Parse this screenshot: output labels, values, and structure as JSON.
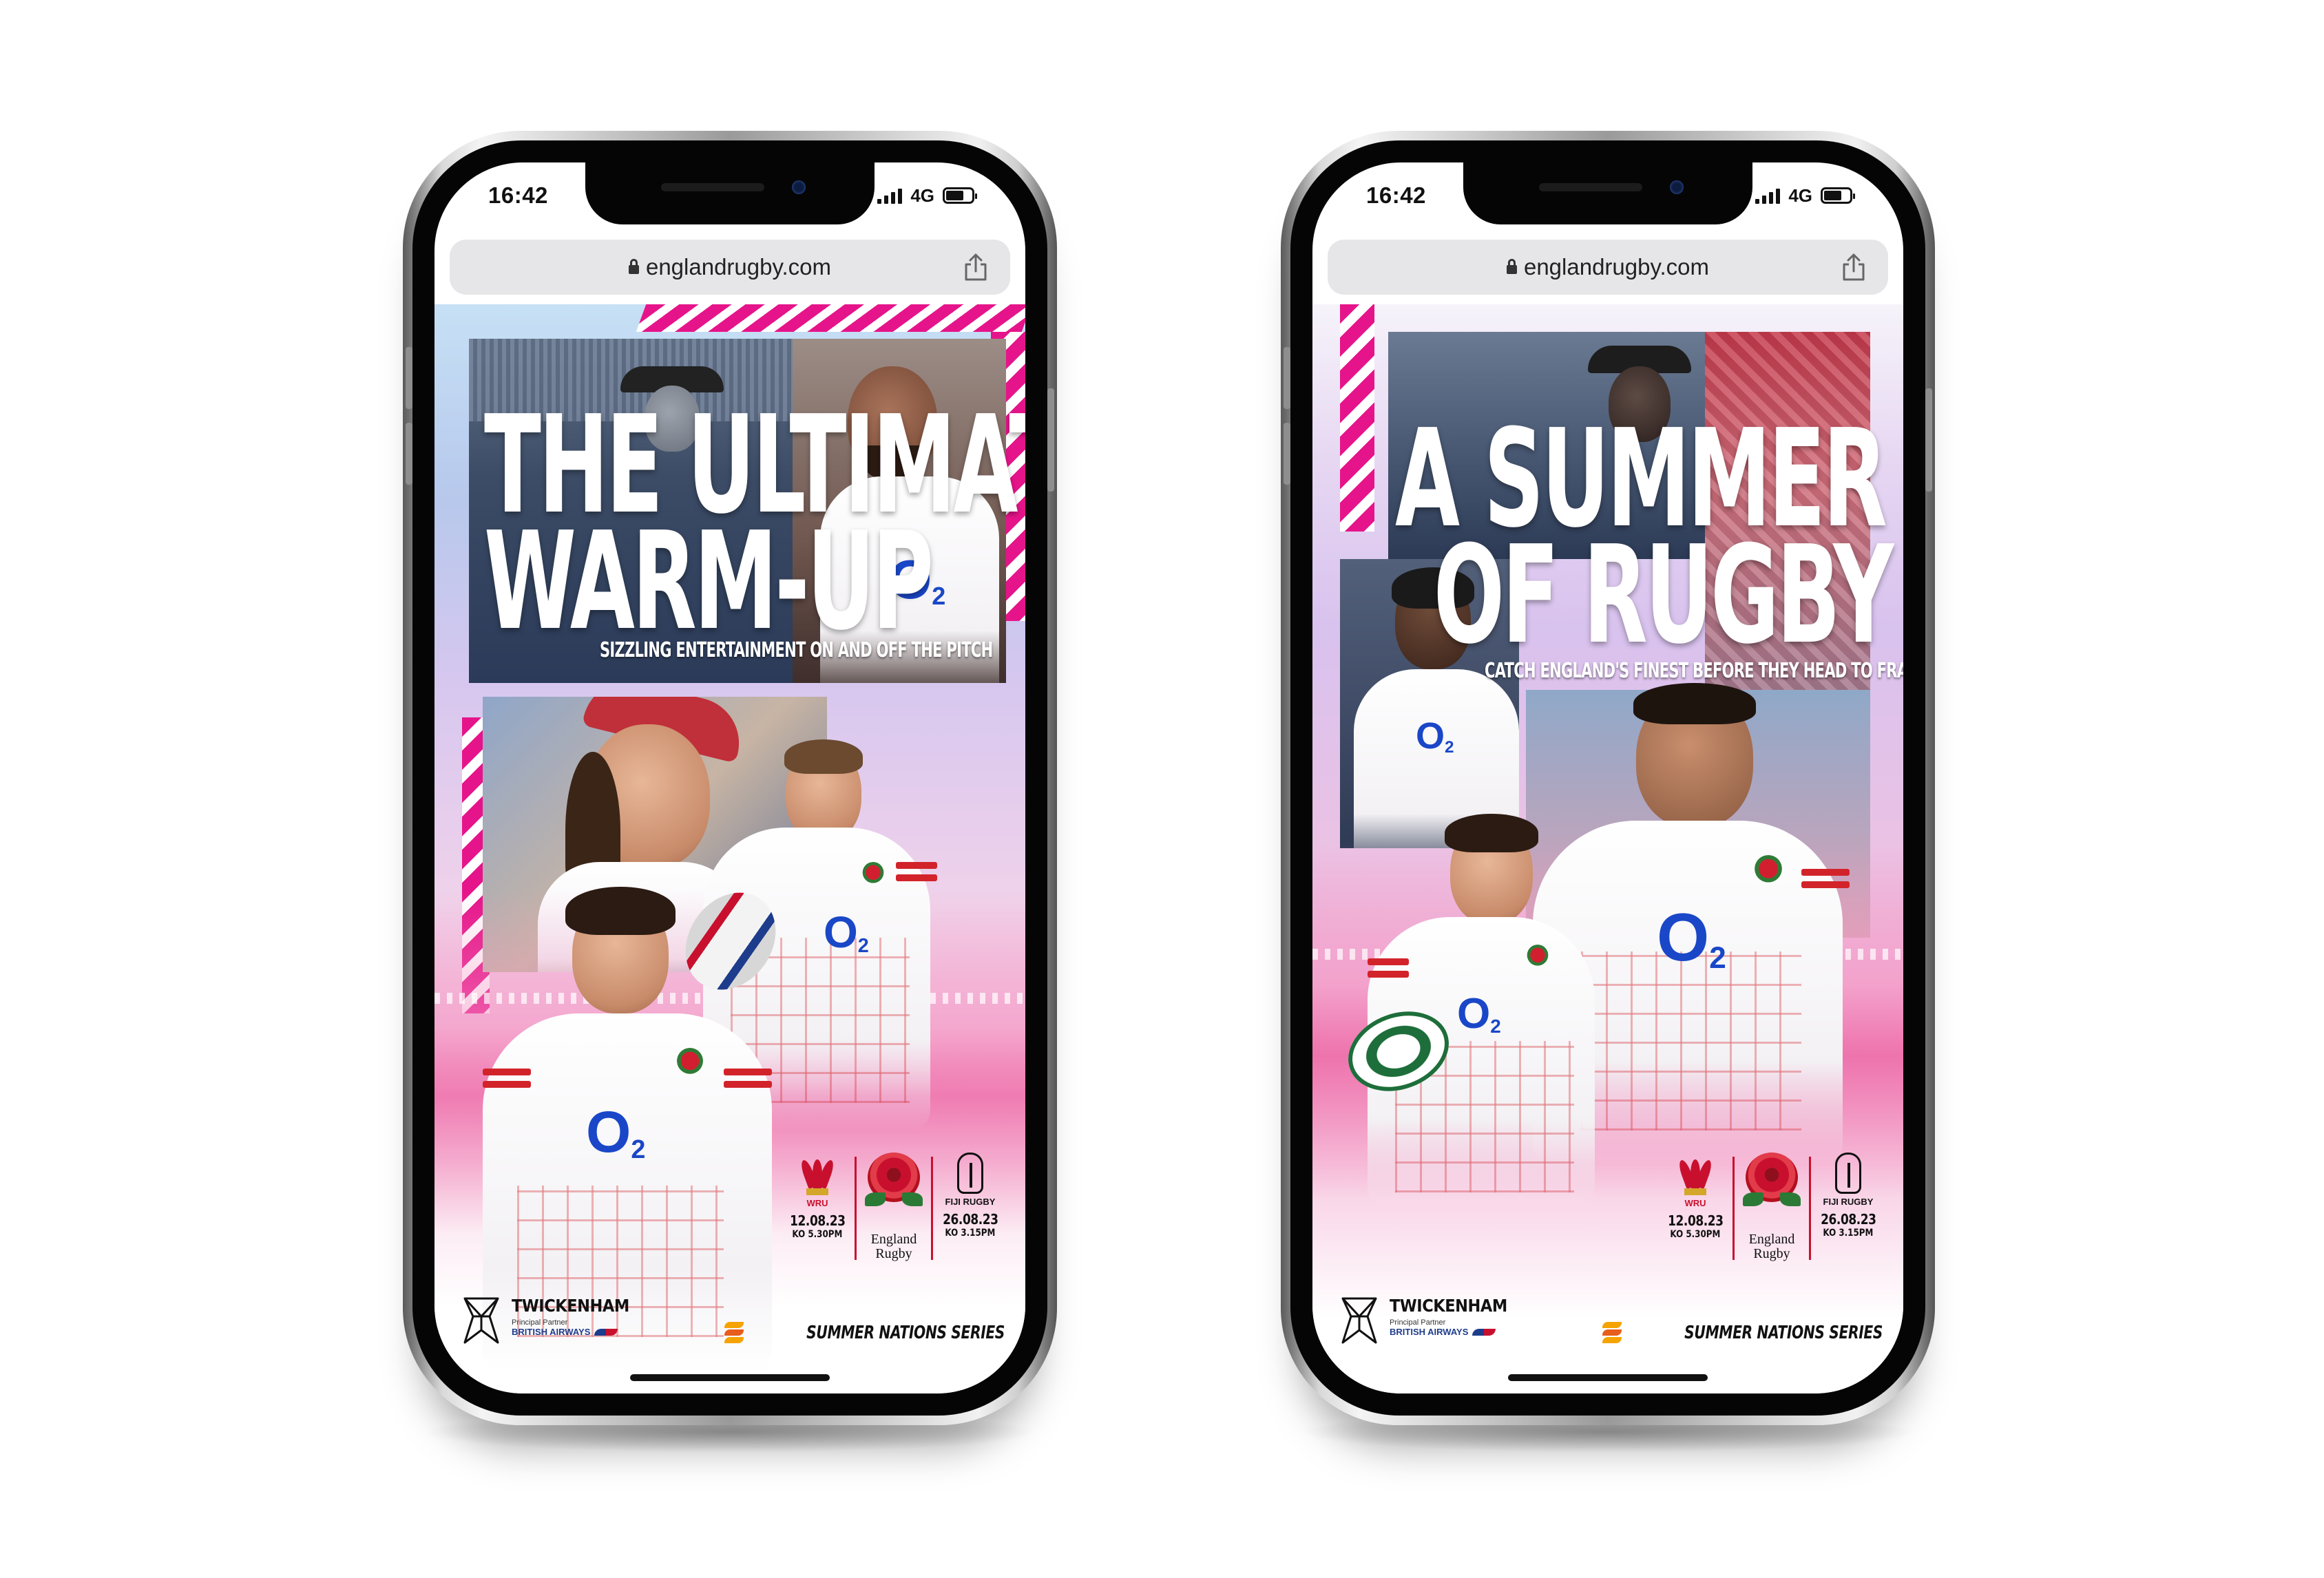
{
  "colors": {
    "accent_pink": "#e6148a",
    "england_red": "#c8102e",
    "o2_blue": "#1a47c8",
    "ba_navy": "#1e3c8c"
  },
  "phones": [
    {
      "status": {
        "time": "16:42",
        "network": "4G"
      },
      "browser": {
        "url": "englandrugby.com"
      },
      "poster": {
        "headline_line1": "THE ULTIMATE",
        "headline_line2": "WARM-UP",
        "subheadline": "SIZZLING ENTERTAINMENT ON AND OFF THE PITCH",
        "shirt_sponsor": "O",
        "shirt_sponsor_sub": "2",
        "fixtures": [
          {
            "org": "WRU",
            "date": "12.08.23",
            "kickoff": "KO 5.30PM"
          },
          {
            "line1": "England",
            "line2": "Rugby"
          },
          {
            "org": "FIJI RUGBY",
            "date": "26.08.23",
            "kickoff": "KO 3.15PM"
          }
        ],
        "venue": "TWICKENHAM",
        "partner_label": "Principal Partner",
        "partner_name": "BRITISH AIRWAYS",
        "series": "SUMMER NATIONS SERIES"
      }
    },
    {
      "status": {
        "time": "16:42",
        "network": "4G"
      },
      "browser": {
        "url": "englandrugby.com"
      },
      "poster": {
        "headline_line1": "A SUMMER",
        "headline_line2": "OF RUGBY",
        "subheadline": "CATCH ENGLAND'S FINEST BEFORE THEY HEAD TO FRANCE",
        "shirt_sponsor": "O",
        "shirt_sponsor_sub": "2",
        "fixtures": [
          {
            "org": "WRU",
            "date": "12.08.23",
            "kickoff": "KO 5.30PM"
          },
          {
            "line1": "England",
            "line2": "Rugby"
          },
          {
            "org": "FIJI RUGBY",
            "date": "26.08.23",
            "kickoff": "KO 3.15PM"
          }
        ],
        "venue": "TWICKENHAM",
        "partner_label": "Principal Partner",
        "partner_name": "BRITISH AIRWAYS",
        "series": "SUMMER NATIONS SERIES"
      }
    }
  ]
}
